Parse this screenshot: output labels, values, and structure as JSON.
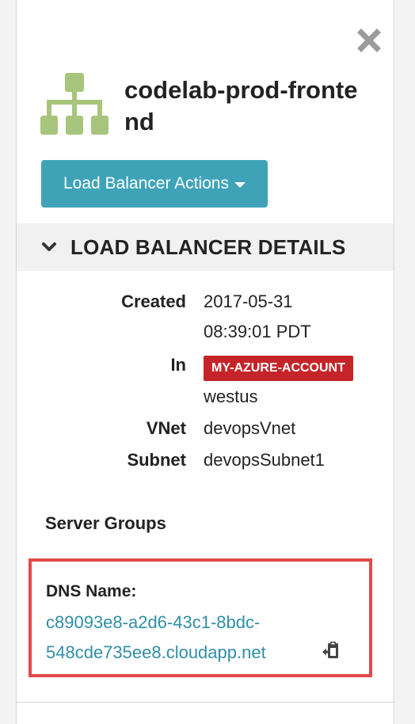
{
  "header": {
    "title": "codelab-prod-frontend",
    "icon": "load-balancer-icon",
    "icon_color": "#a7c57c"
  },
  "close": {
    "icon": "close-icon",
    "color": "#9b9b9b"
  },
  "actions": {
    "label": "Load Balancer Actions",
    "color": "#3fa3b8"
  },
  "section": {
    "title": "LOAD BALANCER DETAILS",
    "expanded": true
  },
  "details": {
    "created_label": "Created",
    "created_date": "2017-05-31",
    "created_time": "08:39:01 PDT",
    "in_label": "In",
    "account": "MY-AZURE-ACCOUNT",
    "account_color": "#c52428",
    "region": "westus",
    "vnet_label": "VNet",
    "vnet": "devopsVnet",
    "subnet_label": "Subnet",
    "subnet": "devopsSubnet1"
  },
  "server_groups": {
    "label": "Server Groups"
  },
  "dns": {
    "label": "DNS Name:",
    "line1": "c89093e8-a2d6-43c1-8bdc-",
    "line2": "548cde735ee8.cloudapp.net",
    "highlight_color": "#e04a4a",
    "link_color": "#2f8fa6"
  }
}
